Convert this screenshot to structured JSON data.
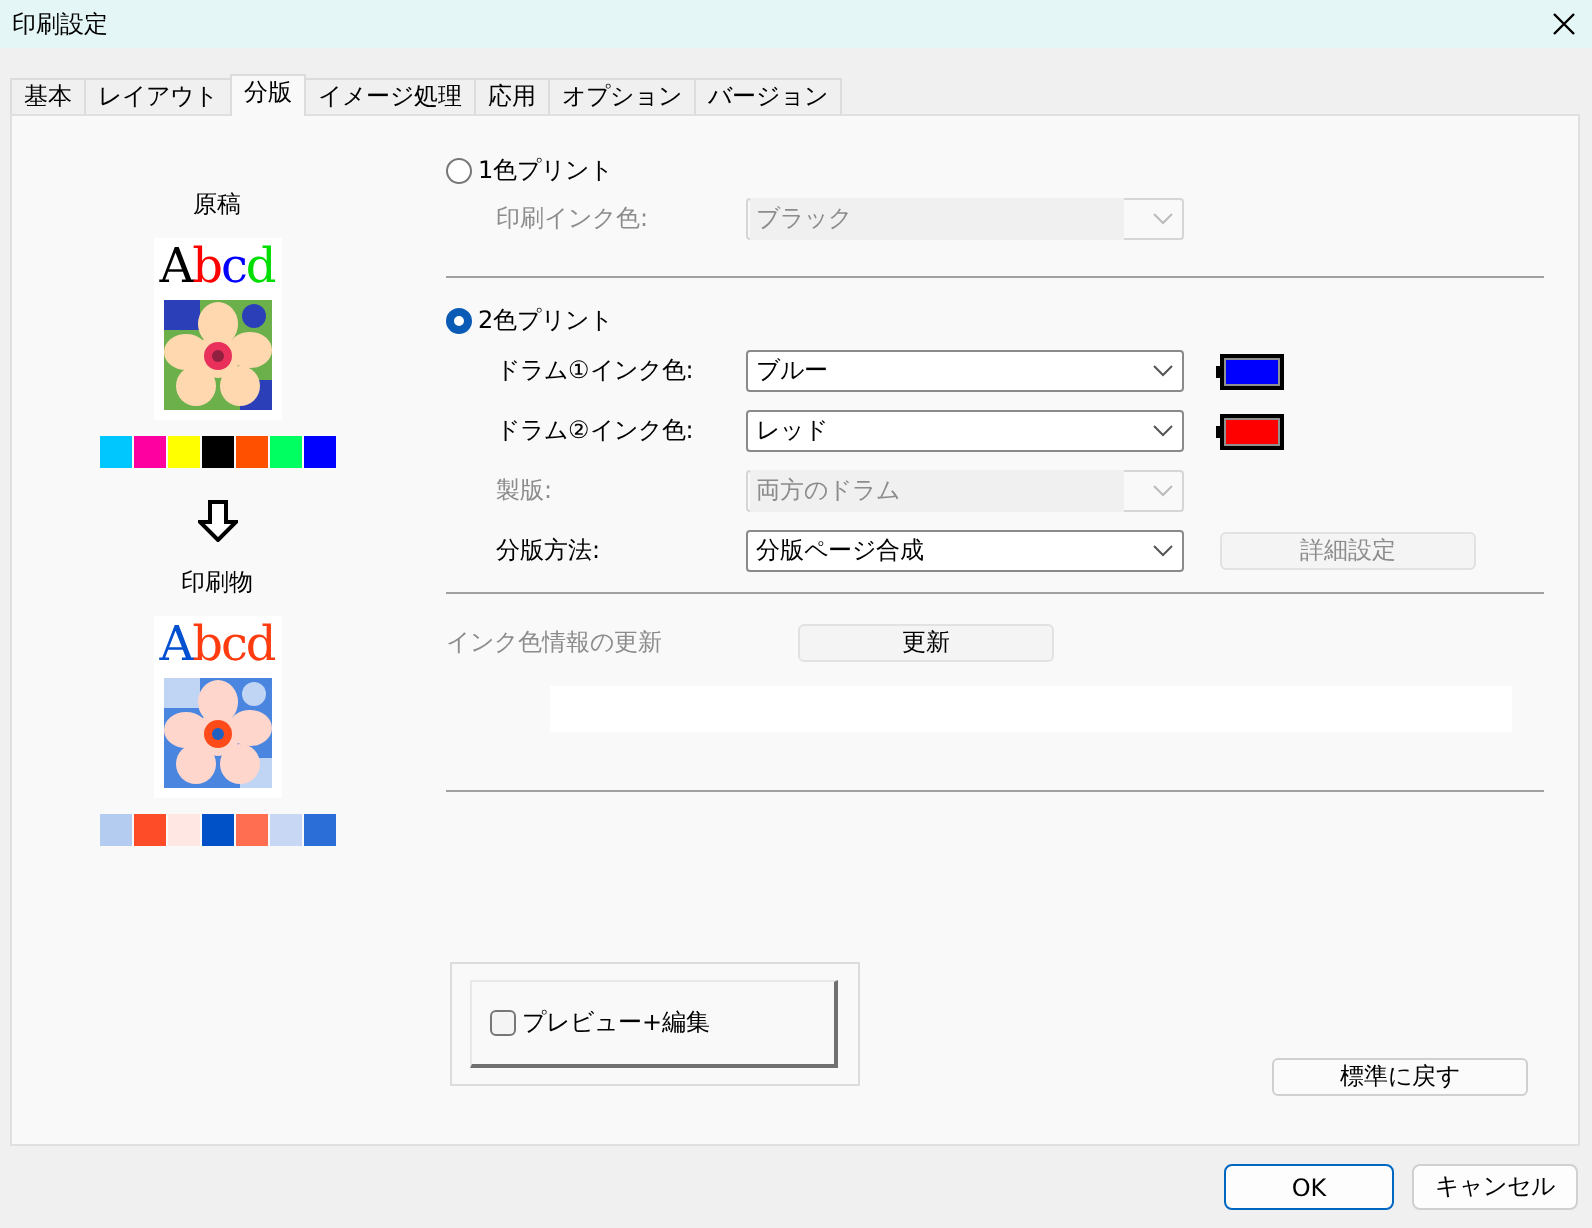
{
  "window": {
    "title": "印刷設定"
  },
  "tabs": [
    {
      "label": "基本",
      "selected": false
    },
    {
      "label": "レイアウト",
      "selected": false
    },
    {
      "label": "分版",
      "selected": true
    },
    {
      "label": "イメージ処理",
      "selected": false
    },
    {
      "label": "応用",
      "selected": false
    },
    {
      "label": "オプション",
      "selected": false
    },
    {
      "label": "バージョン",
      "selected": false
    }
  ],
  "preview": [
    {
      "label": "原稿",
      "letters": [
        {
          "text": "A",
          "color": "#000000"
        },
        {
          "text": "b",
          "color": "#ff0000"
        },
        {
          "text": "c",
          "color": "#0000ff"
        },
        {
          "text": "d",
          "color": "#00dd00"
        }
      ],
      "swatches": [
        {
          "color": "#00c8ff"
        },
        {
          "color": "#ff00a0"
        },
        {
          "color": "#ffff00"
        },
        {
          "color": "#000000"
        },
        {
          "color": "#ff5000"
        },
        {
          "color": "#00ff60"
        },
        {
          "color": "#0000ff"
        }
      ]
    },
    {
      "label": "印刷物",
      "letters": [
        {
          "text": "A",
          "color": "#0050d0"
        },
        {
          "text": "b",
          "color": "#ff3c10"
        },
        {
          "text": "c",
          "color": "#ff3c10"
        },
        {
          "text": "d",
          "color": "#ff3c10"
        }
      ],
      "swatches": [
        {
          "color": "#b4ccf0"
        },
        {
          "color": "#ff4c28"
        },
        {
          "color": "#ffe8e4"
        },
        {
          "color": "#0050c8"
        },
        {
          "color": "#ff6e50"
        },
        {
          "color": "#c8d8f4"
        },
        {
          "color": "#2c6ed8"
        }
      ]
    }
  ],
  "modes": [
    {
      "label": "1色プリント",
      "selected": false,
      "fields": [
        {
          "label": "印刷インク色:",
          "value": "ブラック",
          "disabled": true
        }
      ]
    },
    {
      "label": "2色プリント",
      "selected": true,
      "fields": [
        {
          "label": "ドラム①インク色:",
          "value": "ブルー",
          "disabled": false,
          "color": "#0000ff"
        },
        {
          "label": "ドラム②インク色:",
          "value": "レッド",
          "disabled": false,
          "color": "#ff0000"
        },
        {
          "label": "製版:",
          "value": "両方のドラム",
          "disabled": true
        },
        {
          "label": "分版方法:",
          "value": "分版ページ合成",
          "disabled": false,
          "button": {
            "label": "詳細設定",
            "disabled": true
          }
        }
      ]
    }
  ],
  "ink_update": {
    "label": "インク色情報の更新",
    "disabled": true,
    "button": "更新"
  },
  "preview_edit": {
    "label": "プレビュー+編集",
    "checked": false
  },
  "reset_button": "標準に戻す",
  "buttons": [
    {
      "label": "OK",
      "default": true
    },
    {
      "label": "キャンセル",
      "default": false
    }
  ]
}
